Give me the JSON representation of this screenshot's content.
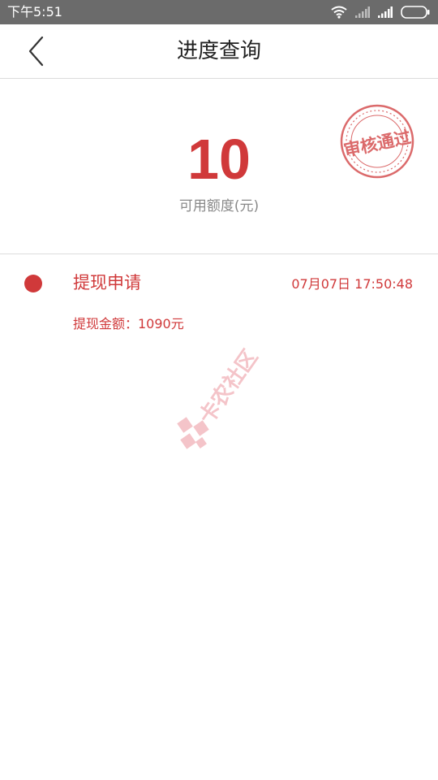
{
  "status_bar": {
    "time": "下午5:51",
    "icons": [
      "wifi-icon",
      "signal-icon",
      "signal-icon",
      "battery-icon"
    ]
  },
  "nav": {
    "back_icon": "chevron-left-icon",
    "title": "进度查询"
  },
  "summary": {
    "available_credit": "10",
    "available_credit_label": "可用额度(元)",
    "stamp_text": "审核通过"
  },
  "record": {
    "title": "提现申请",
    "timestamp": "07月07日 17:50:48",
    "amount_text": "提现金额：1090元"
  },
  "watermark": {
    "text": "卡农社区"
  },
  "colors": {
    "accent": "#d0393a",
    "status_bar_bg": "#6b6b6b",
    "title_text": "#222222",
    "muted_text": "#888888",
    "divider": "#dcdcdc",
    "watermark": "#e25a66"
  }
}
